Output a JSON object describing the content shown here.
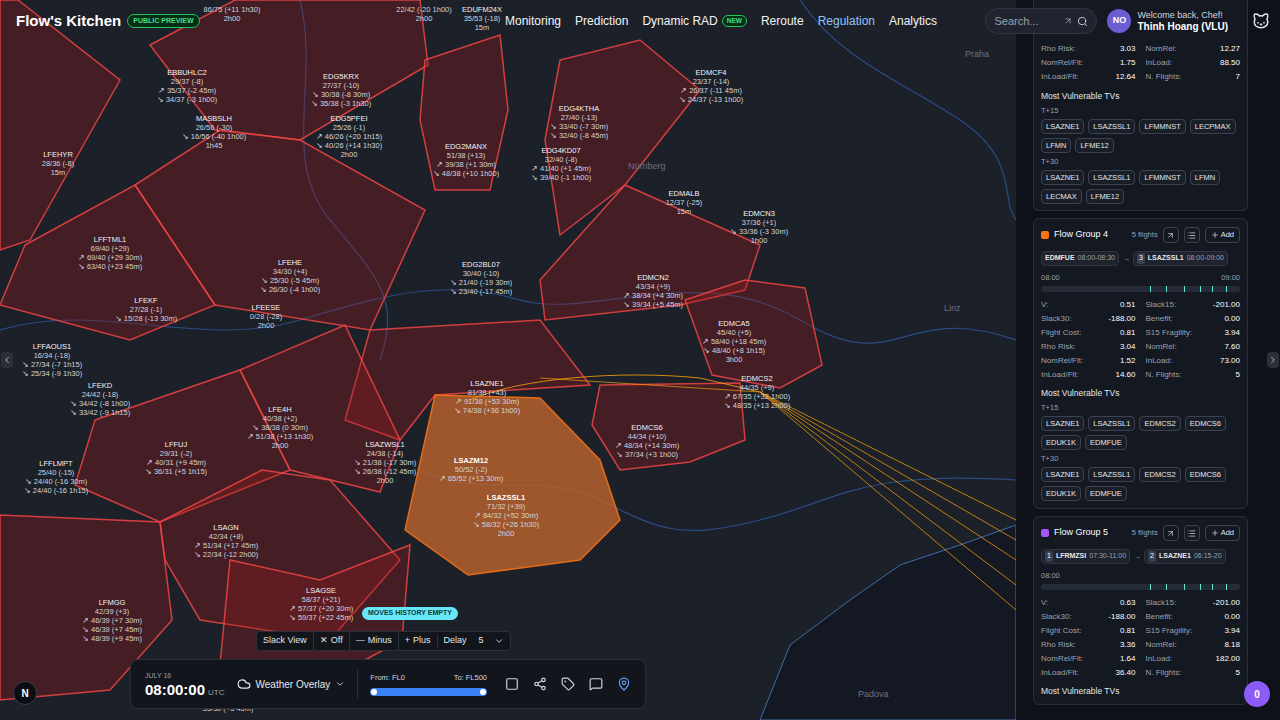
{
  "header": {
    "logo": "Flow's Kitchen",
    "badge": "PUBLIC PREVIEW",
    "nav": [
      {
        "label": "Monitoring",
        "selected": false,
        "badge": ""
      },
      {
        "label": "Prediction",
        "selected": false,
        "badge": ""
      },
      {
        "label": "Dynamic RAD",
        "selected": false,
        "badge": "NEW"
      },
      {
        "label": "Reroute",
        "selected": false,
        "badge": ""
      },
      {
        "label": "Regulation",
        "selected": true,
        "badge": ""
      },
      {
        "label": "Analytics",
        "selected": false,
        "badge": ""
      }
    ],
    "search": {
      "placeholder": "Search..."
    },
    "user": {
      "initials": "NO",
      "greeting": "Welcome back, Chef!",
      "name": "Thinh Hoang (VLU)"
    }
  },
  "map": {
    "places": [
      "Praha",
      "Nürnberg",
      "Linz",
      "Padova"
    ],
    "sectors": [
      {
        "name": "",
        "lines": [
          "86/75 (+11 1h30)",
          "2h00"
        ],
        "selected": false
      },
      {
        "name": "",
        "lines": [
          "22/42 (-20 1h00)",
          "2h00"
        ],
        "selected": false
      },
      {
        "name": "EDUFM24X",
        "lines": [
          "35/53 (-18)",
          "15m"
        ],
        "selected": false
      },
      {
        "name": "EBBUHLC2",
        "lines": [
          "29/37 (-8)",
          "↗ 35/37 (-2 45m)",
          "↘ 34/37 (-3 1h00)"
        ],
        "selected": false
      },
      {
        "name": "EDG5KRX",
        "lines": [
          "27/37 (-10)",
          "↘ 30/38 (-8 30m)",
          "↘ 35/38 (-3 1h30)"
        ],
        "selected": false
      },
      {
        "name": "MASBSLH",
        "lines": [
          "26/56 (-30)",
          "↘ 16/56 (-40 1h00)",
          "1h45"
        ],
        "selected": false
      },
      {
        "name": "EDG5PFEI",
        "lines": [
          "25/26 (-1)",
          "↗ 46/26 (+20 1h15)",
          "↘ 40/26 (+14 1h30)",
          "2h00"
        ],
        "selected": false
      },
      {
        "name": "EDMCF4",
        "lines": [
          "23/37 (-14)",
          "↗ 26/37 (-11 45m)",
          "↘ 24/37 (-13 1h00)"
        ],
        "selected": false
      },
      {
        "name": "EDG4KTHA",
        "lines": [
          "27/40 (-13)",
          "↘ 33/40 (-7 30m)",
          "↘ 32/40 (-8 45m)"
        ],
        "selected": false
      },
      {
        "name": "EDG2MANX",
        "lines": [
          "51/38 (+13)",
          "↗ 39/38 (+1 30m)",
          "↘ 48/38 (+10 1h00)"
        ],
        "selected": false
      },
      {
        "name": "EDG4KD07",
        "lines": [
          "32/40 (-8)",
          "↗ 41/40 (+1 45m)",
          "↘ 39/40 (-1 1h00)"
        ],
        "selected": false
      },
      {
        "name": "LFEHYR",
        "lines": [
          "28/36 (-8)",
          "15m"
        ],
        "selected": false
      },
      {
        "name": "EDMALB",
        "lines": [
          "12/37 (-25)",
          "15m"
        ],
        "selected": false
      },
      {
        "name": "EDMCN3",
        "lines": [
          "37/36 (+1)",
          "↘ 33/36 (-3 30m)",
          "1h00"
        ],
        "selected": false
      },
      {
        "name": "LFFTML1",
        "lines": [
          "69/40 (+29)",
          "↗ 69/40 (+29 30m)",
          "↘ 63/40 (+23 45m)"
        ],
        "selected": false
      },
      {
        "name": "LFEHE",
        "lines": [
          "34/30 (+4)",
          "↘ 25/30 (-5 45m)",
          "↘ 26/30 (-4 1h00)"
        ],
        "selected": false
      },
      {
        "name": "EDG2BL07",
        "lines": [
          "30/40 (-10)",
          "↘ 21/40 (-19 30m)",
          "↘ 23/40 (-17 45m)"
        ],
        "selected": false
      },
      {
        "name": "EDMCN2",
        "lines": [
          "43/34 (+9)",
          "↗ 38/34 (+4 30m)",
          "↘ 39/34 (+5 45m)"
        ],
        "selected": false
      },
      {
        "name": "LFEKF",
        "lines": [
          "27/28 (-1)",
          "↘ 15/28 (-13 30m)"
        ],
        "selected": false
      },
      {
        "name": "LFEESE",
        "lines": [
          "0/28 (-28)",
          "2h00"
        ],
        "selected": false
      },
      {
        "name": "EDMCA5",
        "lines": [
          "45/40 (+5)",
          "↗ 58/40 (+18 45m)",
          "↘ 48/40 (+8 1h15)",
          "3h00"
        ],
        "selected": false
      },
      {
        "name": "LFFAOUS1",
        "lines": [
          "16/34 (-18)",
          "↘ 27/34 (-7 1h15)",
          "↘ 25/34 (-9 1h30)"
        ],
        "selected": false
      },
      {
        "name": "EDMCS2",
        "lines": [
          "44/35 (+9)",
          "↗ 67/35 (+32 1h00)",
          "↘ 48/35 (+13 2h00)"
        ],
        "selected": false
      },
      {
        "name": "LSAZNE1",
        "lines": [
          "81/38 (+43)",
          "↗ 91/38 (+53 30m)",
          "↘ 74/38 (+36 1h00)"
        ],
        "selected": false
      },
      {
        "name": "LFEKD",
        "lines": [
          "24/42 (-18)",
          "↘ 34/42 (-8 1h00)",
          "↘ 33/42 (-9 1h15)"
        ],
        "selected": false
      },
      {
        "name": "LFE4H",
        "lines": [
          "40/38 (+2)",
          "↘ 38/38 (0 30m)",
          "↗ 51/38 (+13 1h30)",
          "2h00"
        ],
        "selected": false
      },
      {
        "name": "EDMCS6",
        "lines": [
          "44/34 (+10)",
          "↗ 48/34 (+14 30m)",
          "↘ 37/34 (+3 1h00)"
        ],
        "selected": false
      },
      {
        "name": "LFFUJ",
        "lines": [
          "29/31 (-2)",
          "↗ 40/31 (+9 45m)",
          "↘ 36/31 (+5 1h15)"
        ],
        "selected": false
      },
      {
        "name": "LSAZWSL1",
        "lines": [
          "24/38 (-14)",
          "↘ 21/38 (-17 30m)",
          "↘ 26/38 (-12 45m)",
          "2h00"
        ],
        "selected": false
      },
      {
        "name": "LFFLMPT",
        "lines": [
          "25/40 (-15)",
          "↘ 24/40 (-16 30m)",
          "↘ 24/40 (-16 1h15)"
        ],
        "selected": false
      },
      {
        "name": "LSAZM12",
        "lines": [
          "50/52 (-2)",
          "↗ 65/52 (+13 30m)"
        ],
        "selected": true
      },
      {
        "name": "LSAZSSL1",
        "lines": [
          "71/32 (+39)",
          "↗ 84/32 (+52 30m)",
          "↘ 58/32 (+26 1h30)",
          "2h00"
        ],
        "selected": true
      },
      {
        "name": "LSAGN",
        "lines": [
          "42/34 (+8)",
          "↗ 51/34 (+17 45m)",
          "↘ 22/34 (-12 2h00)"
        ],
        "selected": false
      },
      {
        "name": "LSAGSE",
        "lines": [
          "58/37 (+21)",
          "↗ 57/37 (+20 30m)",
          "↘ 59/37 (+22 45m)"
        ],
        "selected": false
      },
      {
        "name": "LFMGG",
        "lines": [
          "42/39 (+3)",
          "↗ 46/39 (+7 30m)",
          "↘ 46/39 (+7 45m)",
          "↘ 48/39 (+9 45m)"
        ],
        "selected": false
      },
      {
        "name": "",
        "lines": [
          "35/30 (+5 45m)"
        ],
        "selected": false
      }
    ],
    "moves_badge": "MOVES HISTORY EMPTY",
    "north": "N"
  },
  "slack_toolbar": {
    "title": "Slack View",
    "options": [
      {
        "glyph": "✕",
        "label": "Off"
      },
      {
        "glyph": "—",
        "label": "Minus"
      },
      {
        "glyph": "+",
        "label": "Plus"
      }
    ],
    "delay_label": "Delay",
    "delay_value": "5"
  },
  "time_bar": {
    "date": "JULY 16",
    "time": "08:00:00",
    "zone": "UTC",
    "overlay": "Weather Overlay",
    "from": "From: FL0",
    "to": "To: FL500",
    "range": {
      "from_level": 0,
      "to_level": 1
    },
    "tools": [
      {
        "selected": false
      },
      {
        "selected": false
      },
      {
        "selected": false
      },
      {
        "selected": false
      },
      {
        "selected": true
      }
    ]
  },
  "panel": {
    "top_card": {
      "metrics": [
        {
          "label": "Rho Risk:",
          "value": "3.03"
        },
        {
          "label": "NomRel:",
          "value": "12.27"
        },
        {
          "label": "NomRel/Flt:",
          "value": "1.75"
        },
        {
          "label": "InLoad:",
          "value": "88.50"
        },
        {
          "label": "InLoad/Flt:",
          "value": "12.64"
        },
        {
          "label": "N. Flights:",
          "value": "7"
        }
      ],
      "vulnerable": {
        "title": "Most Vulnerable TVs",
        "horizons": [
          {
            "label": "T+15",
            "tvs": [
              "LSAZNE1",
              "LSAZSSL1",
              "LFMMNST",
              "LECPMAX",
              "LFMN",
              "LFME12"
            ]
          },
          {
            "label": "T+30",
            "tvs": [
              "LSAZNE1",
              "LSAZSSL1",
              "LFMMNST",
              "LFMN",
              "LECMAX",
              "LFME12"
            ]
          }
        ]
      }
    },
    "groups": [
      {
        "title": "Flow Group 4",
        "color": "#f97316",
        "flights": "5 flights",
        "add": "Add",
        "arrow": "→",
        "route": [
          {
            "num": "",
            "code": "EDMFUE",
            "time": "08:00-08:30"
          },
          {
            "num": "3",
            "code": "LSAZSSL1",
            "time": "08:00-09:00"
          }
        ],
        "timeline": {
          "start": "08:00",
          "end": "09:00"
        },
        "metrics": [
          {
            "label": "V:",
            "value": "0.51"
          },
          {
            "label": "Slack15:",
            "value": "-201.00"
          },
          {
            "label": "Slack30:",
            "value": "-188.00"
          },
          {
            "label": "Benefit:",
            "value": "0.00"
          },
          {
            "label": "Flight Cost:",
            "value": "0.81"
          },
          {
            "label": "S15 Fragility:",
            "value": "3.94"
          },
          {
            "label": "Rho Risk:",
            "value": "3.04"
          },
          {
            "label": "NomRel:",
            "value": "7.60"
          },
          {
            "label": "NomRel/Flt:",
            "value": "1.52"
          },
          {
            "label": "InLoad:",
            "value": "73.00"
          },
          {
            "label": "InLoad/Flt:",
            "value": "14.60"
          },
          {
            "label": "N. Flights:",
            "value": "5"
          }
        ],
        "vulnerable": {
          "title": "Most Vulnerable TVs",
          "horizons": [
            {
              "label": "T+15",
              "tvs": [
                "LSAZNE1",
                "LSAZSSL1",
                "EDMCS2",
                "EDMCS6",
                "EDUK1K",
                "EDMFUE"
              ]
            },
            {
              "label": "T+30",
              "tvs": [
                "LSAZNE1",
                "LSAZSSL1",
                "EDMCS2",
                "EDMCS6",
                "EDUK1K",
                "EDMFUE"
              ]
            }
          ]
        }
      },
      {
        "title": "Flow Group 5",
        "color": "#a855f7",
        "flights": "5 flights",
        "add": "Add",
        "arrow": "→",
        "route": [
          {
            "num": "1",
            "code": "LFRMZSI",
            "time": "07:30-11:00"
          },
          {
            "num": "2",
            "code": "LSAZNE1",
            "time": "06:15-20"
          }
        ],
        "timeline": {
          "start": "08:00",
          "end": ""
        },
        "metrics": [
          {
            "label": "V:",
            "value": "0.63"
          },
          {
            "label": "Slack15:",
            "value": "-201.00"
          },
          {
            "label": "Slack30:",
            "value": "-188.00"
          },
          {
            "label": "Benefit:",
            "value": "0.00"
          },
          {
            "label": "Flight Cost:",
            "value": "0.81"
          },
          {
            "label": "S15 Fragility:",
            "value": "3.94"
          },
          {
            "label": "Rho Risk:",
            "value": "3.36"
          },
          {
            "label": "NomRel:",
            "value": "8.18"
          },
          {
            "label": "NomRel/Flt:",
            "value": "1.64"
          },
          {
            "label": "InLoad:",
            "value": "182.00"
          },
          {
            "label": "InLoad/Flt:",
            "value": "36.40"
          },
          {
            "label": "N. Flights:",
            "value": "5"
          }
        ],
        "vulnerable": {
          "title": "Most Vulnerable TVs",
          "horizons": []
        }
      }
    ]
  },
  "notifications": "0"
}
